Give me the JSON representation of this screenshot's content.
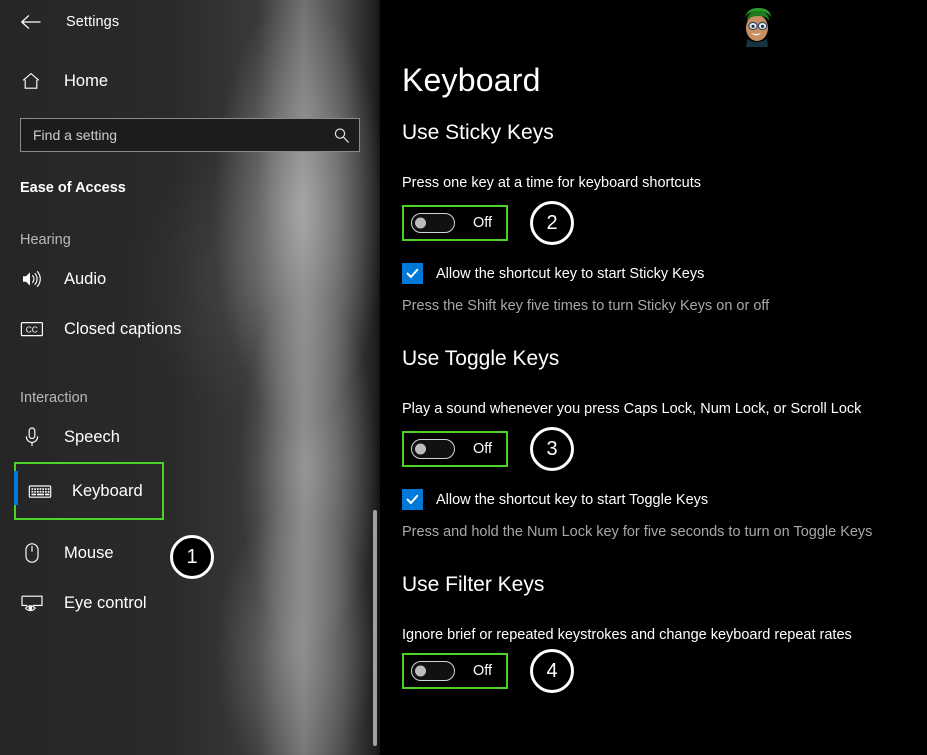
{
  "window": {
    "title": "Settings",
    "back_icon": "back-arrow-icon"
  },
  "sidebar": {
    "home": {
      "label": "Home",
      "icon": "home-icon"
    },
    "search": {
      "placeholder": "Find a setting",
      "value": "",
      "icon": "search-icon"
    },
    "category": "Ease of Access",
    "groups": [
      {
        "label": "Hearing",
        "items": [
          {
            "label": "Audio",
            "icon": "speaker-icon",
            "selected": false
          },
          {
            "label": "Closed captions",
            "icon": "closed-captions-icon",
            "selected": false
          }
        ]
      },
      {
        "label": "Interaction",
        "items": [
          {
            "label": "Speech",
            "icon": "microphone-icon",
            "selected": false
          },
          {
            "label": "Keyboard",
            "icon": "keyboard-icon",
            "selected": true,
            "step": "1"
          },
          {
            "label": "Mouse",
            "icon": "mouse-icon",
            "selected": false
          },
          {
            "label": "Eye control",
            "icon": "eye-control-icon",
            "selected": false
          }
        ]
      }
    ]
  },
  "main": {
    "page_title": "Keyboard",
    "avatar": "cartoon-avatar-icon",
    "sections": [
      {
        "heading": "Use Sticky Keys",
        "description": "Press one key at a time for keyboard shortcuts",
        "toggle": {
          "state": "Off",
          "checked": false
        },
        "step": "2",
        "checkbox": {
          "label": "Allow the shortcut key to start Sticky Keys",
          "checked": true
        },
        "hint": "Press the Shift key five times to turn Sticky Keys on or off"
      },
      {
        "heading": "Use Toggle Keys",
        "description": "Play a sound whenever you press Caps Lock, Num Lock, or Scroll Lock",
        "toggle": {
          "state": "Off",
          "checked": false
        },
        "step": "3",
        "checkbox": {
          "label": "Allow the shortcut key to start Toggle Keys",
          "checked": true
        },
        "hint": "Press and hold the Num Lock key for five seconds to turn on Toggle Keys"
      },
      {
        "heading": "Use Filter Keys",
        "description": "Ignore brief or repeated keystrokes and change keyboard repeat rates",
        "toggle": {
          "state": "Off",
          "checked": false
        },
        "step": "4",
        "checkbox": null,
        "hint": null
      }
    ]
  },
  "colors": {
    "accent_blue": "#0078d7",
    "annotation_green": "#4cd227",
    "background": "#000000",
    "sidebar": "#2b2b2b"
  }
}
